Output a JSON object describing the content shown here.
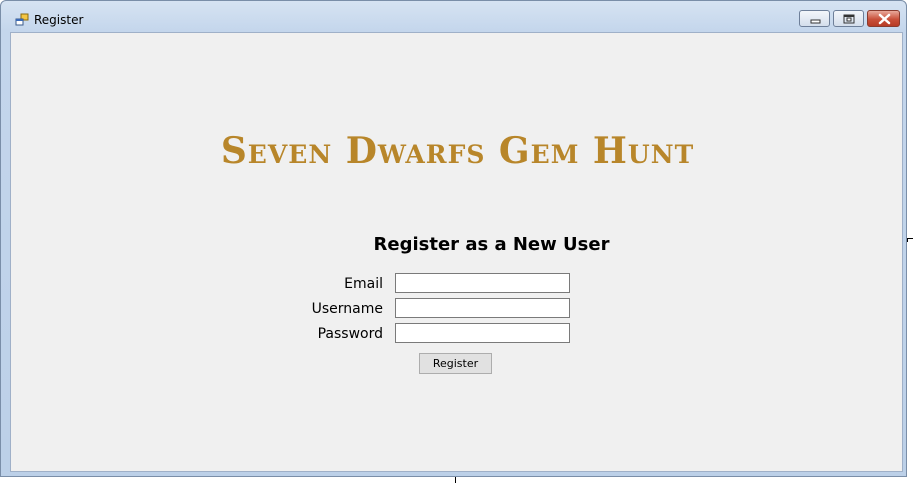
{
  "window": {
    "title": "Register",
    "icon": "app-window-icon"
  },
  "caption_buttons": {
    "minimize_icon": "minimize-icon",
    "maximize_icon": "restore-icon",
    "close_icon": "close-icon"
  },
  "main": {
    "game_title": "Seven Dwarfs Gem Hunt",
    "form_heading": "Register as a New User",
    "fields": {
      "email_label": "Email",
      "email_value": "",
      "username_label": "Username",
      "username_value": "",
      "password_label": "Password",
      "password_value": ""
    },
    "register_button_label": "Register"
  },
  "colors": {
    "title_gold": "#b8862a",
    "client_background": "#f0f0f0",
    "close_button_red": "#c9503a"
  }
}
